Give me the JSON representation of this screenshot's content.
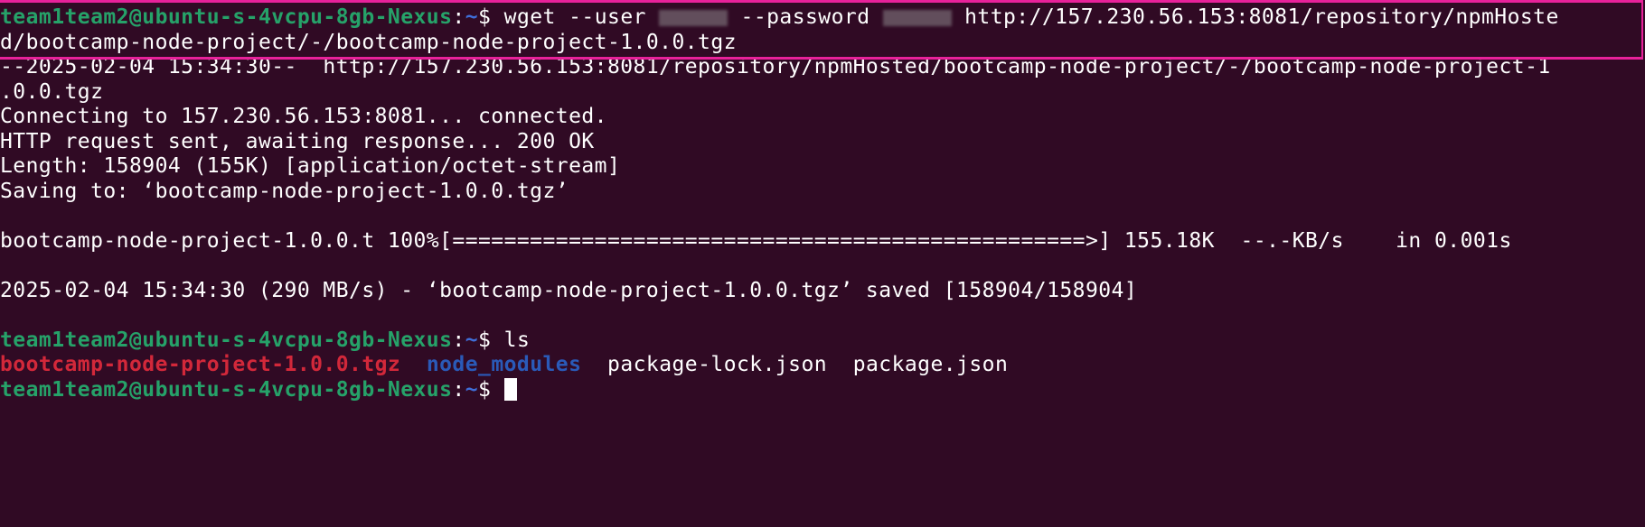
{
  "terminal": {
    "prompt": {
      "user_host": "team1team2@ubuntu-s-4vcpu-8gb-Nexus",
      "path": "~",
      "sign": "$ "
    },
    "command1": {
      "part1": "wget --user ",
      "part2": " --password ",
      "part3": " http://157.230.56.153:8081/repository/npmHoste",
      "wrap": "d/bootcamp-node-project/-/bootcamp-node-project-1.0.0.tgz"
    },
    "output": [
      "--2025-02-04 15:34:30--  http://157.230.56.153:8081/repository/npmHosted/bootcamp-node-project/-/bootcamp-node-project-1",
      ".0.0.tgz",
      "Connecting to 157.230.56.153:8081... connected.",
      "HTTP request sent, awaiting response... 200 OK",
      "Length: 158904 (155K) [application/octet-stream]",
      "Saving to: ‘bootcamp-node-project-1.0.0.tgz’",
      "",
      "bootcamp-node-project-1.0.0.t 100%[=================================================>] 155.18K  --.-KB/s    in 0.001s",
      "",
      "2025-02-04 15:34:30 (290 MB/s) - ‘bootcamp-node-project-1.0.0.tgz’ saved [158904/158904]",
      ""
    ],
    "command2": "ls",
    "ls_output": {
      "tgz": "bootcamp-node-project-1.0.0.tgz",
      "dir": "node_modules",
      "file1": "package-lock.json",
      "file2": "package.json"
    },
    "colors": {
      "background": "#300a24",
      "prompt_user": "#26a269",
      "prompt_path": "#3f6ed8",
      "highlight": "#e8219a",
      "archive_file": "#d2283a",
      "directory": "#2a5ab8"
    }
  }
}
